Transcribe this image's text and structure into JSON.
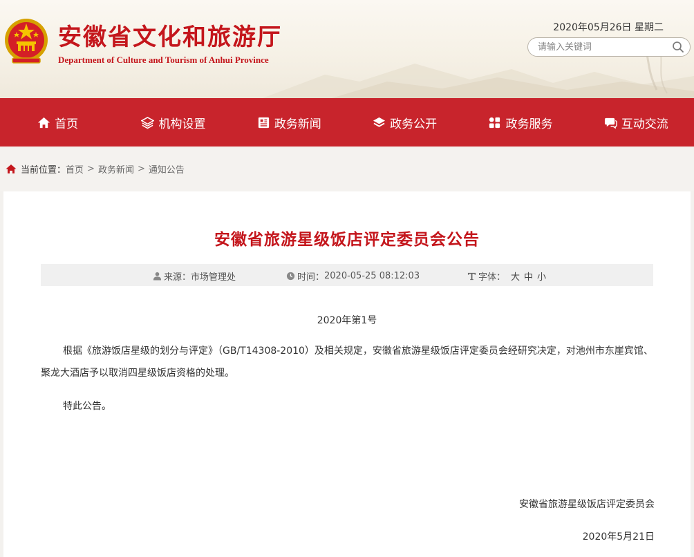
{
  "header": {
    "title_cn": "安徽省文化和旅游厅",
    "title_en": "Department of Culture and Tourism of Anhui Province",
    "date": "2020年05月26日 星期二",
    "search_placeholder": "请输入关键词",
    "emblem_icon": "national-emblem-icon",
    "brand_color": "#c4161c"
  },
  "nav": {
    "items": [
      {
        "label": "首页",
        "icon": "home-icon"
      },
      {
        "label": "机构设置",
        "icon": "layers-icon"
      },
      {
        "label": "政务新闻",
        "icon": "news-icon"
      },
      {
        "label": "政务公开",
        "icon": "stack-icon"
      },
      {
        "label": "政务服务",
        "icon": "grid-icon"
      },
      {
        "label": "互动交流",
        "icon": "chat-icon"
      }
    ],
    "background": "#c8242c"
  },
  "breadcrumb": {
    "label": "当前位置：",
    "items": [
      "首页",
      "政务新闻",
      "通知公告"
    ],
    "separator": ">"
  },
  "article": {
    "title": "安徽省旅游星级饭店评定委员会公告",
    "source_label": "来源：",
    "source": "市场管理处",
    "time_label": "时间：",
    "time": "2020-05-25 08:12:03",
    "font_label": "字体：",
    "font_sizes": [
      "大",
      "中",
      "小"
    ],
    "doc_no": "2020年第1号",
    "paragraphs": [
      "根据《旅游饭店星级的划分与评定》（GB/T14308-2010）及相关规定，安徽省旅游星级饭店评定委员会经研究决定，对池州市东崖宾馆、聚龙大酒店予以取消四星级饭店资格的处理。",
      "特此公告。"
    ],
    "signature": "安徽省旅游星级饭店评定委员会",
    "sign_date": "2020年5月21日"
  }
}
